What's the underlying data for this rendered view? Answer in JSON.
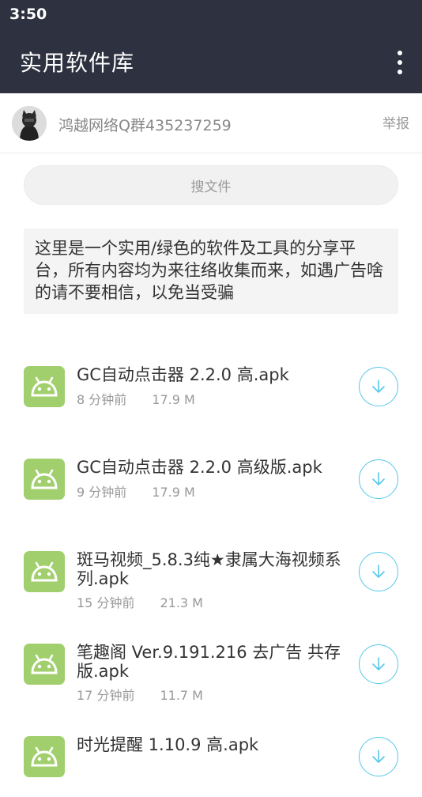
{
  "status_bar": {
    "time": "3:50"
  },
  "app_bar": {
    "title": "实用软件库",
    "menu_icon": "more-vertical-icon"
  },
  "owner": {
    "name": "鸿越网络Q群435237259",
    "report_label": "举报"
  },
  "search": {
    "placeholder": "搜文件"
  },
  "notice": {
    "text": "这里是一个实用/绿色的软件及工具的分享平台，所有内容均为来往络收集而来，如遇广告啥的请不要相信，以免当受骗"
  },
  "colors": {
    "app_bar": "#2e3140",
    "icon_green": "#a2cf6e",
    "download_accent": "#56c8ea"
  },
  "files": [
    {
      "name": "GC自动点击器 2.2.0 高.apk",
      "time": "8 分钟前",
      "size": "17.9 M",
      "icon": "android-icon",
      "action_icon": "download-icon"
    },
    {
      "name": "GC自动点击器 2.2.0 高级版.apk",
      "time": "9 分钟前",
      "size": "17.9 M",
      "icon": "android-icon",
      "action_icon": "download-icon"
    },
    {
      "name": "斑马视频_5.8.3纯★隶属大海视频系列.apk",
      "time": "15 分钟前",
      "size": "21.3 M",
      "icon": "android-icon",
      "action_icon": "download-icon"
    },
    {
      "name": "笔趣阁 Ver.9.191.216 去广告 共存版.apk",
      "time": "17 分钟前",
      "size": "11.7 M",
      "icon": "android-icon",
      "action_icon": "download-icon"
    },
    {
      "name": "时光提醒 1.10.9 高.apk",
      "time": "",
      "size": "",
      "icon": "android-icon",
      "action_icon": "download-icon"
    }
  ]
}
